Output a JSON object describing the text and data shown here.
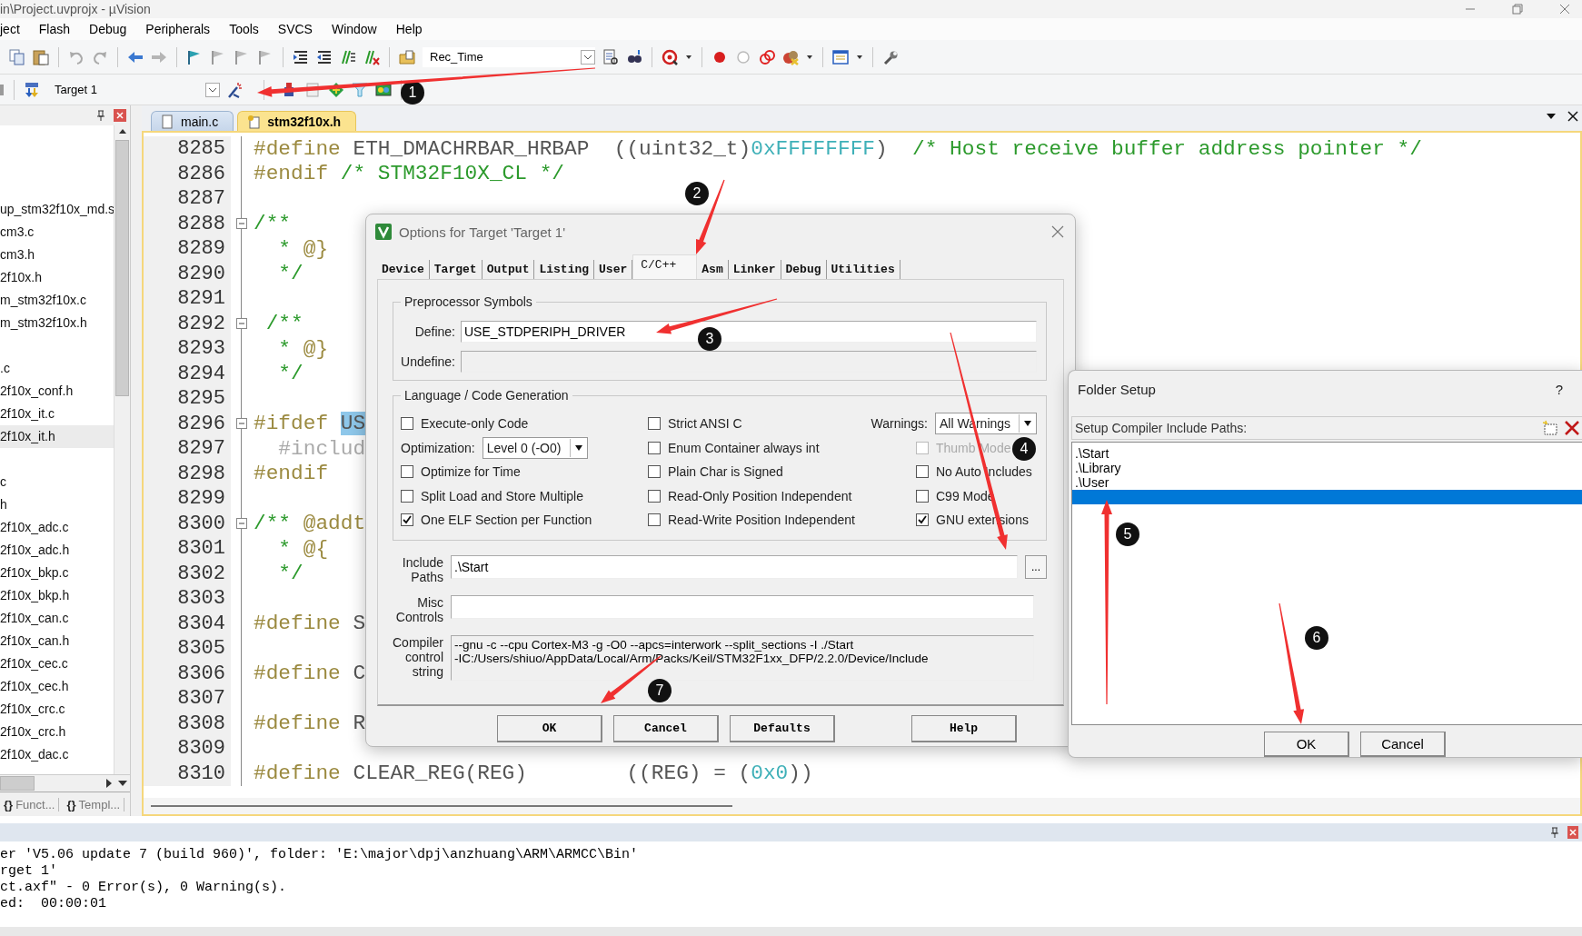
{
  "window": {
    "title": "in\\Project.uvprojx - µVision"
  },
  "menu": [
    "ject",
    "Flash",
    "Debug",
    "Peripherals",
    "Tools",
    "SVCS",
    "Window",
    "Help"
  ],
  "toolbar": {
    "find_combo": "Rec_Time",
    "target_combo": "Target 1"
  },
  "project_panel": {
    "items": [
      {
        "kind": "blank"
      },
      {
        "kind": "blank"
      },
      {
        "kind": "file",
        "text": "up_stm32f10x_md.s",
        "selected": false
      },
      {
        "kind": "file",
        "text": "cm3.c",
        "selected": false
      },
      {
        "kind": "file",
        "text": "cm3.h",
        "selected": false
      },
      {
        "kind": "file",
        "text": "2f10x.h",
        "selected": false
      },
      {
        "kind": "file",
        "text": "m_stm32f10x.c",
        "selected": false
      },
      {
        "kind": "file",
        "text": "m_stm32f10x.h",
        "selected": false
      },
      {
        "kind": "blank"
      },
      {
        "kind": "file",
        "text": ".c",
        "selected": false
      },
      {
        "kind": "file",
        "text": "2f10x_conf.h",
        "selected": false
      },
      {
        "kind": "file",
        "text": "2f10x_it.c",
        "selected": false
      },
      {
        "kind": "file",
        "text": "2f10x_it.h",
        "selected": true
      },
      {
        "kind": "blank"
      },
      {
        "kind": "file",
        "text": "c",
        "selected": false
      },
      {
        "kind": "file",
        "text": "h",
        "selected": false
      },
      {
        "kind": "file",
        "text": "2f10x_adc.c",
        "selected": false
      },
      {
        "kind": "file",
        "text": "2f10x_adc.h",
        "selected": false
      },
      {
        "kind": "file",
        "text": "2f10x_bkp.c",
        "selected": false
      },
      {
        "kind": "file",
        "text": "2f10x_bkp.h",
        "selected": false
      },
      {
        "kind": "file",
        "text": "2f10x_can.c",
        "selected": false
      },
      {
        "kind": "file",
        "text": "2f10x_can.h",
        "selected": false
      },
      {
        "kind": "file",
        "text": "2f10x_cec.c",
        "selected": false
      },
      {
        "kind": "file",
        "text": "2f10x_cec.h",
        "selected": false
      },
      {
        "kind": "file",
        "text": "2f10x_crc.c",
        "selected": false
      },
      {
        "kind": "file",
        "text": "2f10x_crc.h",
        "selected": false
      },
      {
        "kind": "file",
        "text": "2f10x_dac.c",
        "selected": false
      }
    ],
    "tabs": [
      {
        "icon": "{}",
        "label": "Funct..."
      },
      {
        "icon": "{}",
        "label": "Templ..."
      }
    ]
  },
  "editor": {
    "tabs": [
      {
        "label": "main.c",
        "selected": false
      },
      {
        "label": "stm32f10x.h",
        "selected": true
      }
    ],
    "lines": [
      {
        "number": "8285",
        "fold": false,
        "segments": [
          {
            "kind": "pp",
            "text": "#define"
          },
          {
            "kind": "id",
            "text": " ETH_DMACHRBAR_HRBAP  ((uint32_t)"
          },
          {
            "kind": "num",
            "text": "0xFFFFFFFF"
          },
          {
            "kind": "id",
            "text": ")  "
          },
          {
            "kind": "cm",
            "text": "/* Host receive buffer address pointer */"
          }
        ]
      },
      {
        "number": "8286",
        "fold": false,
        "segments": [
          {
            "kind": "pp",
            "text": "#endif"
          },
          {
            "kind": "cm",
            "text": " /* STM32F10X_CL */"
          }
        ]
      },
      {
        "number": "8287",
        "fold": false
      },
      {
        "number": "8288",
        "fold": true,
        "segments": [
          {
            "kind": "cm",
            "text": "/**"
          }
        ]
      },
      {
        "number": "8289",
        "fold": false,
        "segments": [
          {
            "kind": "cm",
            "text": "  * "
          },
          {
            "kind": "pp",
            "text": "@}"
          }
        ]
      },
      {
        "number": "8290",
        "fold": false,
        "segments": [
          {
            "kind": "cm",
            "text": "  */"
          }
        ]
      },
      {
        "number": "8291",
        "fold": false
      },
      {
        "number": "8292",
        "fold": true,
        "segments": [
          {
            "kind": "cm",
            "text": " /**"
          }
        ]
      },
      {
        "number": "8293",
        "fold": false,
        "segments": [
          {
            "kind": "cm",
            "text": "  * "
          },
          {
            "kind": "pp",
            "text": "@}"
          }
        ]
      },
      {
        "number": "8294",
        "fold": false,
        "segments": [
          {
            "kind": "cm",
            "text": "  */"
          }
        ]
      },
      {
        "number": "8295",
        "fold": false
      },
      {
        "number": "8296",
        "fold": true,
        "segments": [
          {
            "kind": "pp",
            "text": "#ifdef "
          },
          {
            "kind": "hl",
            "text": "US"
          }
        ]
      },
      {
        "number": "8297",
        "fold": false,
        "segments": [
          {
            "kind": "inactive",
            "text": "  #includ"
          }
        ]
      },
      {
        "number": "8298",
        "fold": false,
        "segments": [
          {
            "kind": "pp",
            "text": "#endif"
          }
        ]
      },
      {
        "number": "8299",
        "fold": false
      },
      {
        "number": "8300",
        "fold": true,
        "segments": [
          {
            "kind": "cm",
            "text": "/** "
          },
          {
            "kind": "pp",
            "text": "@addt"
          }
        ]
      },
      {
        "number": "8301",
        "fold": false,
        "segments": [
          {
            "kind": "cm",
            "text": "  * "
          },
          {
            "kind": "pp",
            "text": "@{"
          }
        ]
      },
      {
        "number": "8302",
        "fold": false,
        "segments": [
          {
            "kind": "cm",
            "text": "  */"
          }
        ]
      },
      {
        "number": "8303",
        "fold": false
      },
      {
        "number": "8304",
        "fold": false,
        "segments": [
          {
            "kind": "pp",
            "text": "#define"
          },
          {
            "kind": "id",
            "text": " S"
          }
        ]
      },
      {
        "number": "8305",
        "fold": false
      },
      {
        "number": "8306",
        "fold": false,
        "segments": [
          {
            "kind": "pp",
            "text": "#define"
          },
          {
            "kind": "id",
            "text": " C"
          }
        ]
      },
      {
        "number": "8307",
        "fold": false
      },
      {
        "number": "8308",
        "fold": false,
        "segments": [
          {
            "kind": "pp",
            "text": "#define"
          },
          {
            "kind": "id",
            "text": " R"
          }
        ]
      },
      {
        "number": "8309",
        "fold": false
      },
      {
        "number": "8310",
        "fold": false,
        "segments": [
          {
            "kind": "pp",
            "text": "#define"
          },
          {
            "kind": "id",
            "text": " CLEAR_REG(REG)        ((REG) = ("
          },
          {
            "kind": "num",
            "text": "0x0"
          },
          {
            "kind": "id",
            "text": "))"
          }
        ]
      }
    ]
  },
  "options_dialog": {
    "title": "Options for Target 'Target 1'",
    "tabs": [
      {
        "label": "Device",
        "selected": false
      },
      {
        "label": "Target",
        "selected": false
      },
      {
        "label": "Output",
        "selected": false
      },
      {
        "label": "Listing",
        "selected": false
      },
      {
        "label": "User",
        "selected": false
      },
      {
        "label": "C/C++",
        "selected": true
      },
      {
        "label": "Asm",
        "selected": false
      },
      {
        "label": "Linker",
        "selected": false
      },
      {
        "label": "Debug",
        "selected": false
      },
      {
        "label": "Utilities",
        "selected": false
      }
    ],
    "preprocessor": {
      "title": "Preprocessor Symbols",
      "define_label": "Define:",
      "define": "USE_STDPERIPH_DRIVER",
      "undefine_label": "Undefine:"
    },
    "codegen": {
      "title": "Language / Code Generation",
      "columns": [
        [
          {
            "kind": "checkbox",
            "label": "Execute-only Code",
            "checked": false,
            "disabled": false
          },
          {
            "kind": "combo",
            "label": "Optimization:",
            "value": "Level 0 (-O0)"
          },
          {
            "kind": "checkbox",
            "label": "Optimize for Time",
            "checked": false,
            "disabled": false
          },
          {
            "kind": "checkbox",
            "label": "Split Load and Store Multiple",
            "checked": false,
            "disabled": false
          },
          {
            "kind": "checkbox",
            "label": "One ELF Section per Function",
            "checked": true,
            "disabled": false
          }
        ],
        [
          {
            "kind": "checkbox",
            "label": "Strict ANSI C",
            "checked": false,
            "disabled": false
          },
          {
            "kind": "checkbox",
            "label": "Enum Container always int",
            "checked": false,
            "disabled": false
          },
          {
            "kind": "checkbox",
            "label": "Plain Char is Signed",
            "checked": false,
            "disabled": false
          },
          {
            "kind": "checkbox",
            "label": "Read-Only Position Independent",
            "checked": false,
            "disabled": false
          },
          {
            "kind": "checkbox",
            "label": "Read-Write Position Independent",
            "checked": false,
            "disabled": false
          }
        ],
        [
          {
            "kind": "combo",
            "label": "Warnings:",
            "value": "All Warnings"
          },
          {
            "kind": "checkbox",
            "label": "Thumb Mode",
            "checked": false,
            "disabled": true
          },
          {
            "kind": "checkbox",
            "label": "No Auto Includes",
            "checked": false,
            "disabled": false
          },
          {
            "kind": "checkbox",
            "label": "C99 Mode",
            "checked": false,
            "disabled": false
          },
          {
            "kind": "checkbox",
            "label": "GNU extensions",
            "checked": true,
            "disabled": false
          }
        ]
      ]
    },
    "include_paths": {
      "label": "Include Paths",
      "value": ".\\Start",
      "browse": "..."
    },
    "misc_controls": {
      "label": "Misc Controls"
    },
    "compiler_string": {
      "label": "Compiler control string",
      "lines": [
        "--gnu -c --cpu Cortex-M3 -g -O0 --apcs=interwork --split_sections -I ./Start",
        "-IC:/Users/shiuo/AppData/Local/Arm/Packs/Keil/STM32F1xx_DFP/2.2.0/Device/Include"
      ]
    },
    "buttons": [
      "OK",
      "Cancel",
      "Defaults",
      "Help"
    ]
  },
  "folder_dialog": {
    "title": "Folder Setup",
    "help": "?",
    "header": "Setup Compiler Include Paths:",
    "paths": [
      {
        "text": ".\\Start",
        "selected": false
      },
      {
        "text": ".\\Library",
        "selected": false
      },
      {
        "text": ".\\User",
        "selected": false
      }
    ],
    "new_entry": {
      "selected": true
    },
    "buttons": [
      "OK",
      "Cancel"
    ]
  },
  "output": {
    "lines": [
      "er 'V5.06 update 7 (build 960)', folder: 'E:\\major\\dpj\\anzhuang\\ARM\\ARMCC\\Bin'",
      "rget 1'",
      "ct.axf\" - 0 Error(s), 0 Warning(s).",
      "ed:  00:00:01"
    ]
  },
  "annotations": [
    {
      "label": "1"
    },
    {
      "label": "2"
    },
    {
      "label": "3"
    },
    {
      "label": "4"
    },
    {
      "label": "5"
    },
    {
      "label": "6"
    },
    {
      "label": "7"
    }
  ]
}
